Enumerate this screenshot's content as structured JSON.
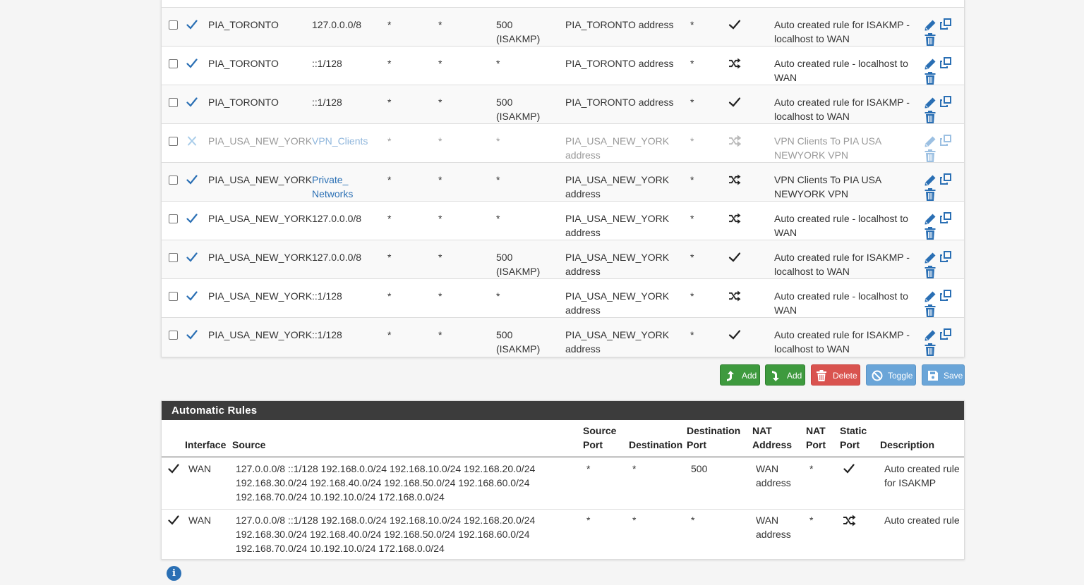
{
  "colors": {
    "accent": "#2a6fb4",
    "success": "#3e9a3e",
    "danger": "#d9534f",
    "toggle_blue": "#6aa5d8",
    "header_dark": "#3c3c3c"
  },
  "mapping_rows": [
    {
      "enabled": true,
      "interface": "PIA_TORONTO",
      "source": "127.0.0.0/8",
      "source_port": "*",
      "destination": "*",
      "dest_port": "500 (ISAKMP)",
      "nat_address": "PIA_TORONTO address",
      "nat_port": "*",
      "static_port": "check-icon",
      "description": "Auto created rule for ISAKMP - localhost to WAN"
    },
    {
      "enabled": true,
      "interface": "PIA_TORONTO",
      "source": "::1/128",
      "source_port": "*",
      "destination": "*",
      "dest_port": "*",
      "nat_address": "PIA_TORONTO address",
      "nat_port": "*",
      "static_port": "random-icon",
      "description": "Auto created rule - localhost to WAN"
    },
    {
      "enabled": true,
      "interface": "PIA_TORONTO",
      "source": "::1/128",
      "source_port": "*",
      "destination": "*",
      "dest_port": "500 (ISAKMP)",
      "nat_address": "PIA_TORONTO address",
      "nat_port": "*",
      "static_port": "check-icon",
      "description": "Auto created rule for ISAKMP - localhost to WAN"
    },
    {
      "enabled": false,
      "interface": "PIA_USA_NEW_YORK",
      "source": "VPN_Clients",
      "source_port": "*",
      "destination": "*",
      "dest_port": "*",
      "nat_address": "PIA_USA_NEW_YORK address",
      "nat_port": "*",
      "static_port": "random-icon",
      "description": "VPN Clients To PIA USA NEWYORK VPN"
    },
    {
      "enabled": true,
      "interface": "PIA_USA_NEW_YORK",
      "source": "Private_ Networks",
      "source_port": "*",
      "destination": "*",
      "dest_port": "*",
      "nat_address": "PIA_USA_NEW_YORK address",
      "nat_port": "*",
      "static_port": "random-icon",
      "description": "VPN Clients To PIA USA NEWYORK VPN"
    },
    {
      "enabled": true,
      "interface": "PIA_USA_NEW_YORK",
      "source": "127.0.0.0/8",
      "source_port": "*",
      "destination": "*",
      "dest_port": "*",
      "nat_address": "PIA_USA_NEW_YORK address",
      "nat_port": "*",
      "static_port": "random-icon",
      "description": "Auto created rule - localhost to WAN"
    },
    {
      "enabled": true,
      "interface": "PIA_USA_NEW_YORK",
      "source": "127.0.0.0/8",
      "source_port": "*",
      "destination": "*",
      "dest_port": "500 (ISAKMP)",
      "nat_address": "PIA_USA_NEW_YORK address",
      "nat_port": "*",
      "static_port": "check-icon",
      "description": "Auto created rule for ISAKMP - localhost to WAN"
    },
    {
      "enabled": true,
      "interface": "PIA_USA_NEW_YORK",
      "source": "::1/128",
      "source_port": "*",
      "destination": "*",
      "dest_port": "*",
      "nat_address": "PIA_USA_NEW_YORK address",
      "nat_port": "*",
      "static_port": "random-icon",
      "description": "Auto created rule - localhost to WAN"
    },
    {
      "enabled": true,
      "interface": "PIA_USA_NEW_YORK",
      "source": "::1/128",
      "source_port": "*",
      "destination": "*",
      "dest_port": "500 (ISAKMP)",
      "nat_address": "PIA_USA_NEW_YORK address",
      "nat_port": "*",
      "static_port": "check-icon",
      "description": "Auto created rule for ISAKMP - localhost to WAN"
    }
  ],
  "buttons": {
    "add_top": "Add",
    "add_bottom": "Add",
    "delete": "Delete",
    "toggle": "Toggle",
    "save": "Save"
  },
  "auto": {
    "title": "Automatic Rules",
    "headers": {
      "interface": "Interface",
      "source": "Source",
      "source_port": "Source Port",
      "destination": "Destination",
      "dest_port": "Destination Port",
      "nat_address": "NAT Address",
      "nat_port": "NAT Port",
      "static_port": "Static Port",
      "description": "Description"
    },
    "rows": [
      {
        "interface": "WAN",
        "source": "127.0.0.0/8 ::1/128 192.168.0.0/24 192.168.10.0/24 192.168.20.0/24 192.168.30.0/24 192.168.40.0/24 192.168.50.0/24 192.168.60.0/24 192.168.70.0/24 10.192.10.0/24 172.168.0.0/24",
        "source_port": "*",
        "destination": "*",
        "dest_port": "500",
        "nat_address": "WAN address",
        "nat_port": "*",
        "static_port": "check-icon",
        "description": "Auto created rule for ISAKMP"
      },
      {
        "interface": "WAN",
        "source": "127.0.0.0/8 ::1/128 192.168.0.0/24 192.168.10.0/24 192.168.20.0/24 192.168.30.0/24 192.168.40.0/24 192.168.50.0/24 192.168.60.0/24 192.168.70.0/24 10.192.10.0/24 172.168.0.0/24",
        "source_port": "*",
        "destination": "*",
        "dest_port": "*",
        "nat_address": "WAN address",
        "nat_port": "*",
        "static_port": "random-icon",
        "description": "Auto created rule"
      }
    ]
  },
  "info_icon": "i"
}
